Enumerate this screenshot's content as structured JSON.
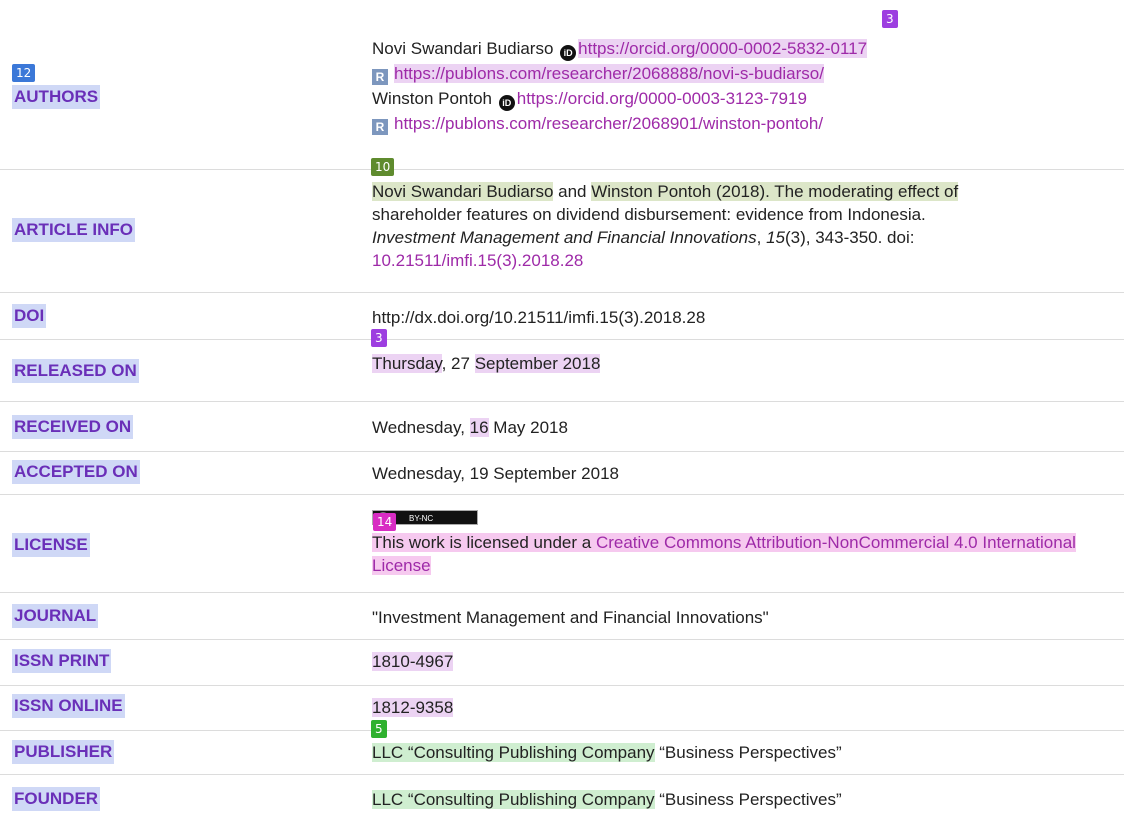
{
  "rows": {
    "authors": {
      "label": "AUTHORS",
      "author1_name": "Novi Swandari Budiarso",
      "author1_orcid_a": "https://orcid.org/0000-0002",
      "author1_orcid_b": "-5832-0117",
      "author1_publons": "https://publons.com/researcher/2068888/novi-s-budiarso/",
      "author2_name": "Winston Pontoh",
      "author2_orcid": "https://orcid.org/0000-0003-3123-7919",
      "author2_publons": "https://publons.com/researcher/2068901/winston-pontoh/"
    },
    "article_info": {
      "label": "ARTICLE INFO",
      "author1": "Novi Swandari Budiarso",
      "and": " and ",
      "author2_title": "Winston Pontoh (2018). The moderating effect of",
      "line2": "shareholder features on dividend disbursement: evidence from Indonesia.",
      "journal_italic": "Investment Management and Financial Innovations",
      "sep": ", ",
      "volume_italic": "15",
      "pages": "(3), 343-350. doi:",
      "doi_link": "10.21511/imfi.15(3).2018.28"
    },
    "doi": {
      "label": "DOI",
      "value": "http://dx.doi.org/10.21511/imfi.15(3).2018.28"
    },
    "released_on": {
      "label": "RELEASED ON",
      "day": "Thursday",
      "mid": ", 27 ",
      "month_year": "September 2018"
    },
    "received_on": {
      "label": "RECEIVED ON",
      "pre": "Wednesday, ",
      "day_num": "16",
      "post": " May 2018"
    },
    "accepted_on": {
      "label": "ACCEPTED ON",
      "value": "Wednesday, 19 September 2018"
    },
    "license": {
      "label": "LICENSE",
      "badge_text": "BY-NC",
      "text": "This work is licensed under a ",
      "link": "Creative Commons Attribution-NonCommercial 4.0 International License"
    },
    "journal": {
      "label": "JOURNAL",
      "value": "\"Investment Management and Financial Innovations\""
    },
    "issn_print": {
      "label": "ISSN PRINT",
      "value": "1810-4967"
    },
    "issn_online": {
      "label": "ISSN ONLINE",
      "value": "1812-9358"
    },
    "publisher": {
      "label": "PUBLISHER",
      "company": "LLC “Consulting Publishing Company",
      "rest": " “Business Perspectives”"
    },
    "founder": {
      "label": "FOUNDER",
      "company": "LLC “Consulting Publishing Company",
      "rest": " “Business Perspectives”"
    }
  },
  "tags": {
    "t12": "12",
    "t3a": "3",
    "t10": "10",
    "t3b": "3",
    "t14": "14",
    "t5": "5"
  },
  "colors": {
    "label_text": "#6a2fb8",
    "label_bg": "#cfd8f6",
    "link": "#9e2aa8",
    "tag_blue": "#3b78d8",
    "tag_purple": "#9d3ee0",
    "tag_olive": "#5f8b2e",
    "tag_magenta": "#d82cc3",
    "tag_green": "#2eb12e"
  }
}
